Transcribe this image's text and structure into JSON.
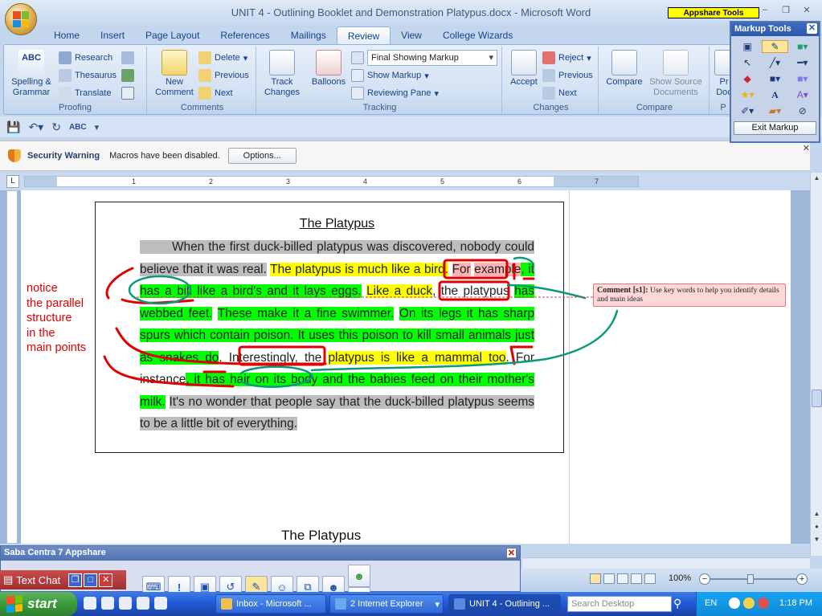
{
  "window": {
    "title": "UNIT 4 - Outlining Booklet and Demonstration Platypus.docx - Microsoft Word",
    "appshare_badge": "Appshare Tools",
    "controls": [
      "–",
      "▫",
      "✕"
    ]
  },
  "ribbon": {
    "tabs": [
      "Home",
      "Insert",
      "Page Layout",
      "References",
      "Mailings",
      "Review",
      "View",
      "College Wizards"
    ],
    "active_tab": "Review",
    "proofing": {
      "label": "Proofing",
      "spelling": "Spelling &",
      "spelling2": "Grammar",
      "research": "Research",
      "thesaurus": "Thesaurus",
      "translate": "Translate"
    },
    "comments": {
      "label": "Comments",
      "new1": "New",
      "new2": "Comment",
      "delete": "Delete",
      "previous": "Previous",
      "next": "Next"
    },
    "tracking": {
      "label": "Tracking",
      "track1": "Track",
      "track2": "Changes",
      "balloons": "Balloons",
      "display_value": "Final Showing Markup",
      "show_markup": "Show Markup",
      "reviewing_pane": "Reviewing Pane"
    },
    "changes": {
      "label": "Changes",
      "accept": "Accept",
      "reject": "Reject",
      "previous": "Previous",
      "next": "Next"
    },
    "compare": {
      "label": "Compare",
      "compare": "Compare",
      "show_source1": "Show Source",
      "show_source2": "Documents"
    },
    "protect": {
      "label": "P",
      "pr": "Pr",
      "doc": "Doc"
    }
  },
  "security": {
    "title": "Security Warning",
    "message": "Macros have been disabled.",
    "options": "Options..."
  },
  "ruler": {
    "numbers": [
      "1",
      "2",
      "3",
      "4",
      "5",
      "6",
      "7"
    ]
  },
  "document": {
    "title": "The Platypus",
    "second_title": "The Platypus",
    "note_lines": [
      "notice",
      "the parallel",
      "structure",
      "in the",
      "main points"
    ],
    "comment_label": "Comment [s1]:",
    "comment_text": "Use key words to help you identify details and main ideas",
    "p": {
      "s1": "When the first duck-billed platypus was discovered, nobody could believe that it was real.",
      "s2": "The platypus is much like a bird.",
      "s3a": "For",
      "s3b": "example",
      "s3c": ", it has a bill like a bird's and it lays eggs.",
      "s4": "Like a duck",
      "s5": ", the platypus",
      "s6": "has webbed feet.",
      "s7": "These make it a fine swimmer.",
      "s8": "On its legs it has sharp spurs which contain poison. It uses this poison to kill small animals just as snakes do",
      "s9": ". Interestingly, the",
      "s10": "platypus is like a mammal too",
      "s11": ".",
      "s12": "For instance",
      "s13": ", it has hair on its body and the babies feed on their mother's milk.",
      "s14": "It's no wonder that people say that the duck-billed platypus seems to be a little bit of everything."
    }
  },
  "markup_tools": {
    "title": "Markup Tools",
    "exit": "Exit Markup"
  },
  "status": {
    "zoom": "100%"
  },
  "saba": {
    "title": "Saba Centra 7 Appshare",
    "text_chat": "Text Chat",
    "count": "1"
  },
  "taskbar": {
    "start": "start",
    "tasks": [
      "Inbox - Microsoft ...",
      "2 Internet Explorer",
      "UNIT 4 - Outlining ..."
    ],
    "search_placeholder": "Search Desktop",
    "lang": "EN",
    "time": "1:18 PM"
  },
  "colors": {
    "highlight_yellow": "#ffff00",
    "highlight_green": "#00ff00",
    "highlight_gray": "#bdbdbd",
    "highlight_pink": "#ffb3b3",
    "pen_red": "#e00000",
    "pen_teal": "#0a9a7a"
  }
}
